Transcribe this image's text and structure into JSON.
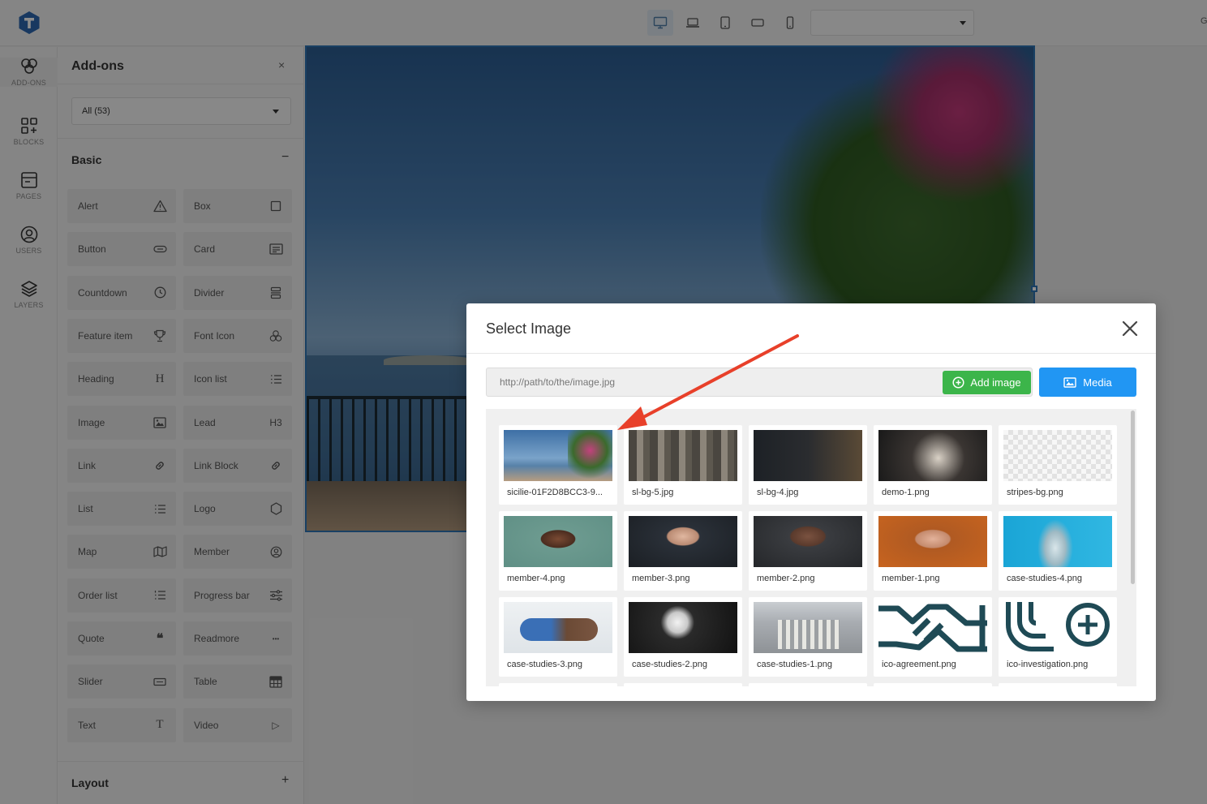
{
  "topbar": {
    "devices": [
      "desktop-icon",
      "laptop-icon",
      "tablet-icon",
      "tablet-landscape-icon",
      "mobile-icon"
    ],
    "active_device": "desktop-icon",
    "right_text": "G"
  },
  "rail": [
    {
      "label": "ADD-ONS",
      "icon": "addons-icon",
      "active": true
    },
    {
      "label": "BLOCKS",
      "icon": "blocks-icon"
    },
    {
      "label": "PAGES",
      "icon": "pages-icon"
    },
    {
      "label": "USERS",
      "icon": "users-icon"
    },
    {
      "label": "LAYERS",
      "icon": "layers-icon"
    }
  ],
  "panel": {
    "title": "Add-ons",
    "close": "×",
    "filter": "All (53)",
    "sections": [
      {
        "title": "Basic",
        "toggle": "−"
      },
      {
        "title": "Layout",
        "toggle": "+"
      }
    ],
    "addons": [
      {
        "label": "Alert",
        "icon": "warning-icon"
      },
      {
        "label": "Box",
        "icon": "square-icon"
      },
      {
        "label": "Button",
        "icon": "button-icon"
      },
      {
        "label": "Card",
        "icon": "card-icon"
      },
      {
        "label": "Countdown",
        "icon": "clock-icon"
      },
      {
        "label": "Divider",
        "icon": "divider-icon"
      },
      {
        "label": "Feature item",
        "icon": "trophy-icon"
      },
      {
        "label": "Font Icon",
        "icon": "font-icon-icon"
      },
      {
        "label": "Heading",
        "icon": "heading-icon",
        "glyph": "H"
      },
      {
        "label": "Icon list",
        "icon": "list-icon"
      },
      {
        "label": "Image",
        "icon": "image-icon"
      },
      {
        "label": "Lead",
        "icon": "lead-icon",
        "glyph": "H3"
      },
      {
        "label": "Link",
        "icon": "link-icon"
      },
      {
        "label": "Link Block",
        "icon": "link-icon"
      },
      {
        "label": "List",
        "icon": "list-icon"
      },
      {
        "label": "Logo",
        "icon": "hexagon-icon"
      },
      {
        "label": "Map",
        "icon": "map-icon"
      },
      {
        "label": "Member",
        "icon": "user-circle-icon"
      },
      {
        "label": "Order list",
        "icon": "ordered-list-icon"
      },
      {
        "label": "Progress bar",
        "icon": "sliders-icon"
      },
      {
        "label": "Quote",
        "icon": "quote-icon",
        "glyph": "❝"
      },
      {
        "label": "Readmore",
        "icon": "dots-icon",
        "glyph": "•••"
      },
      {
        "label": "Slider",
        "icon": "slider-icon"
      },
      {
        "label": "Table",
        "icon": "table-icon"
      },
      {
        "label": "Text",
        "icon": "text-icon",
        "glyph": "T"
      },
      {
        "label": "Video",
        "icon": "play-icon",
        "glyph": "▷"
      }
    ]
  },
  "modal": {
    "title": "Select Image",
    "url_placeholder": "http://path/to/the/image.jpg",
    "add_label": "Add image",
    "media_label": "Media",
    "images": [
      {
        "name": "sicilie-01F2D8BCC3-9...",
        "thumb": "t-sicilie"
      },
      {
        "name": "sl-bg-5.jpg",
        "thumb": "t-sl5"
      },
      {
        "name": "sl-bg-4.jpg",
        "thumb": "t-sl4"
      },
      {
        "name": "demo-1.png",
        "thumb": "t-demo"
      },
      {
        "name": "stripes-bg.png",
        "thumb": "t-stripes"
      },
      {
        "name": "member-4.png",
        "thumb": "t-m4"
      },
      {
        "name": "member-3.png",
        "thumb": "t-m3"
      },
      {
        "name": "member-2.png",
        "thumb": "t-m2"
      },
      {
        "name": "member-1.png",
        "thumb": "t-m1"
      },
      {
        "name": "case-studies-4.png",
        "thumb": "t-cs4"
      },
      {
        "name": "case-studies-3.png",
        "thumb": "t-cs3"
      },
      {
        "name": "case-studies-2.png",
        "thumb": "t-cs2"
      },
      {
        "name": "case-studies-1.png",
        "thumb": "t-cs1"
      },
      {
        "name": "ico-agreement.png",
        "thumb": "t-agree"
      },
      {
        "name": "ico-investigation.png",
        "thumb": "t-invest"
      }
    ]
  },
  "colors": {
    "accent": "#2f76b5",
    "add_button": "#3cb54a",
    "media_button": "#2196f3",
    "annotation_arrow": "#e8402a",
    "icon_teal": "#1f4a55"
  }
}
